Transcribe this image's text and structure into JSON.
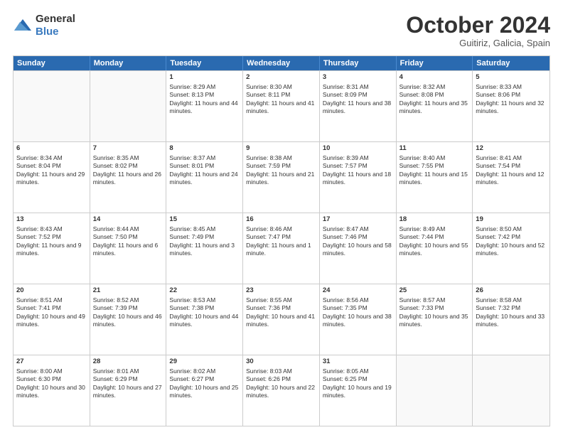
{
  "logo": {
    "general": "General",
    "blue": "Blue"
  },
  "title": "October 2024",
  "subtitle": "Guitiriz, Galicia, Spain",
  "headers": [
    "Sunday",
    "Monday",
    "Tuesday",
    "Wednesday",
    "Thursday",
    "Friday",
    "Saturday"
  ],
  "weeks": [
    [
      {
        "day": "",
        "info": "",
        "empty": true
      },
      {
        "day": "",
        "info": "",
        "empty": true
      },
      {
        "day": "1",
        "info": "Sunrise: 8:29 AM\nSunset: 8:13 PM\nDaylight: 11 hours and 44 minutes."
      },
      {
        "day": "2",
        "info": "Sunrise: 8:30 AM\nSunset: 8:11 PM\nDaylight: 11 hours and 41 minutes."
      },
      {
        "day": "3",
        "info": "Sunrise: 8:31 AM\nSunset: 8:09 PM\nDaylight: 11 hours and 38 minutes."
      },
      {
        "day": "4",
        "info": "Sunrise: 8:32 AM\nSunset: 8:08 PM\nDaylight: 11 hours and 35 minutes."
      },
      {
        "day": "5",
        "info": "Sunrise: 8:33 AM\nSunset: 8:06 PM\nDaylight: 11 hours and 32 minutes."
      }
    ],
    [
      {
        "day": "6",
        "info": "Sunrise: 8:34 AM\nSunset: 8:04 PM\nDaylight: 11 hours and 29 minutes."
      },
      {
        "day": "7",
        "info": "Sunrise: 8:35 AM\nSunset: 8:02 PM\nDaylight: 11 hours and 26 minutes."
      },
      {
        "day": "8",
        "info": "Sunrise: 8:37 AM\nSunset: 8:01 PM\nDaylight: 11 hours and 24 minutes."
      },
      {
        "day": "9",
        "info": "Sunrise: 8:38 AM\nSunset: 7:59 PM\nDaylight: 11 hours and 21 minutes."
      },
      {
        "day": "10",
        "info": "Sunrise: 8:39 AM\nSunset: 7:57 PM\nDaylight: 11 hours and 18 minutes."
      },
      {
        "day": "11",
        "info": "Sunrise: 8:40 AM\nSunset: 7:55 PM\nDaylight: 11 hours and 15 minutes."
      },
      {
        "day": "12",
        "info": "Sunrise: 8:41 AM\nSunset: 7:54 PM\nDaylight: 11 hours and 12 minutes."
      }
    ],
    [
      {
        "day": "13",
        "info": "Sunrise: 8:43 AM\nSunset: 7:52 PM\nDaylight: 11 hours and 9 minutes."
      },
      {
        "day": "14",
        "info": "Sunrise: 8:44 AM\nSunset: 7:50 PM\nDaylight: 11 hours and 6 minutes."
      },
      {
        "day": "15",
        "info": "Sunrise: 8:45 AM\nSunset: 7:49 PM\nDaylight: 11 hours and 3 minutes."
      },
      {
        "day": "16",
        "info": "Sunrise: 8:46 AM\nSunset: 7:47 PM\nDaylight: 11 hours and 1 minute."
      },
      {
        "day": "17",
        "info": "Sunrise: 8:47 AM\nSunset: 7:46 PM\nDaylight: 10 hours and 58 minutes."
      },
      {
        "day": "18",
        "info": "Sunrise: 8:49 AM\nSunset: 7:44 PM\nDaylight: 10 hours and 55 minutes."
      },
      {
        "day": "19",
        "info": "Sunrise: 8:50 AM\nSunset: 7:42 PM\nDaylight: 10 hours and 52 minutes."
      }
    ],
    [
      {
        "day": "20",
        "info": "Sunrise: 8:51 AM\nSunset: 7:41 PM\nDaylight: 10 hours and 49 minutes."
      },
      {
        "day": "21",
        "info": "Sunrise: 8:52 AM\nSunset: 7:39 PM\nDaylight: 10 hours and 46 minutes."
      },
      {
        "day": "22",
        "info": "Sunrise: 8:53 AM\nSunset: 7:38 PM\nDaylight: 10 hours and 44 minutes."
      },
      {
        "day": "23",
        "info": "Sunrise: 8:55 AM\nSunset: 7:36 PM\nDaylight: 10 hours and 41 minutes."
      },
      {
        "day": "24",
        "info": "Sunrise: 8:56 AM\nSunset: 7:35 PM\nDaylight: 10 hours and 38 minutes."
      },
      {
        "day": "25",
        "info": "Sunrise: 8:57 AM\nSunset: 7:33 PM\nDaylight: 10 hours and 35 minutes."
      },
      {
        "day": "26",
        "info": "Sunrise: 8:58 AM\nSunset: 7:32 PM\nDaylight: 10 hours and 33 minutes."
      }
    ],
    [
      {
        "day": "27",
        "info": "Sunrise: 8:00 AM\nSunset: 6:30 PM\nDaylight: 10 hours and 30 minutes."
      },
      {
        "day": "28",
        "info": "Sunrise: 8:01 AM\nSunset: 6:29 PM\nDaylight: 10 hours and 27 minutes."
      },
      {
        "day": "29",
        "info": "Sunrise: 8:02 AM\nSunset: 6:27 PM\nDaylight: 10 hours and 25 minutes."
      },
      {
        "day": "30",
        "info": "Sunrise: 8:03 AM\nSunset: 6:26 PM\nDaylight: 10 hours and 22 minutes."
      },
      {
        "day": "31",
        "info": "Sunrise: 8:05 AM\nSunset: 6:25 PM\nDaylight: 10 hours and 19 minutes."
      },
      {
        "day": "",
        "info": "",
        "empty": true
      },
      {
        "day": "",
        "info": "",
        "empty": true
      }
    ]
  ]
}
